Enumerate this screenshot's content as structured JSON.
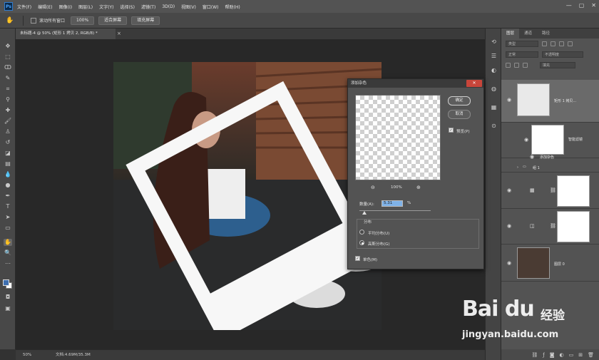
{
  "app": {
    "logo_text": "Ps"
  },
  "menu": [
    "文件(F)",
    "编辑(E)",
    "图像(I)",
    "图层(L)",
    "文字(Y)",
    "选择(S)",
    "滤镜(T)",
    "3D(D)",
    "视图(V)",
    "窗口(W)",
    "帮助(H)"
  ],
  "window_controls": [
    "—",
    "▢",
    "✕"
  ],
  "options_bar": {
    "scroll_all": "滚动所有窗口",
    "zoom_100": "100%",
    "fit_screen": "适合屏幕",
    "fill_screen": "填充屏幕"
  },
  "document_tab": {
    "title": "未标题-4 @ 50% (矩形 1 拷贝 2, RGB/8) *",
    "close": "×"
  },
  "status_bar": {
    "zoom": "50%",
    "info": "文档:4.69M/35.3M"
  },
  "layers_panel": {
    "tabs": [
      "图层",
      "通道",
      "路径"
    ],
    "filter_label": "类型",
    "blend_mode": "正常",
    "opacity_label": "不透明度",
    "fill_label": "填充",
    "layers": [
      {
        "name": "矩形 1 拷贝..."
      },
      {
        "name": "智能滤镜"
      },
      {
        "name": "添加杂色"
      },
      {
        "name": "组 1"
      },
      {
        "name": ""
      },
      {
        "name": ""
      },
      {
        "name": "图层 0"
      }
    ]
  },
  "dialog": {
    "title": "添加杂色",
    "close": "✕",
    "ok": "确定",
    "cancel": "取消",
    "preview_label": "预览(P)",
    "zoom_out": "⊖",
    "zoom_value": "100%",
    "zoom_in": "⊕",
    "amount_label": "数量(A):",
    "amount_value": "5.31",
    "amount_unit": "%",
    "distribution_label": "分布",
    "uniform": "平均分布(U)",
    "gaussian": "高斯分布(G)",
    "monochromatic": "单色(M)"
  },
  "watermark": {
    "brand": "Bai du",
    "brand_cn": "经验",
    "url": "jingyan.baidu.com"
  }
}
